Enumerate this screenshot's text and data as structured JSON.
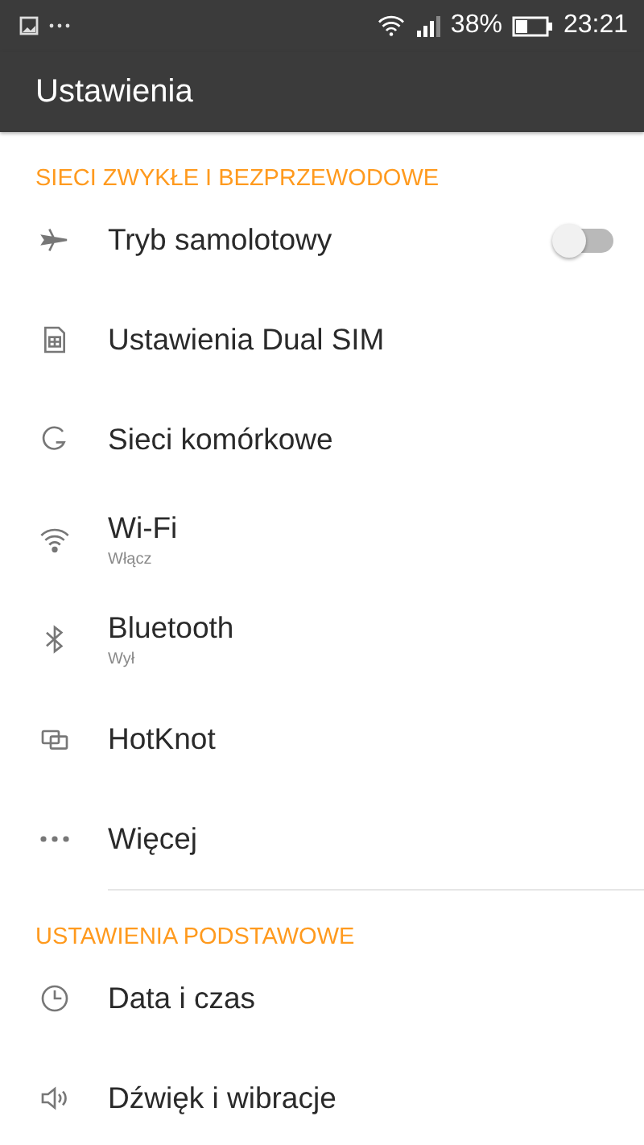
{
  "status_bar": {
    "battery_text": "38%",
    "time": "23:21"
  },
  "app_bar": {
    "title": "Ustawienia"
  },
  "sections": [
    {
      "title": "SIECI ZWYKŁE I BEZPRZEWODOWE",
      "items": [
        {
          "kind": "toggle",
          "label": "Tryb samolotowy",
          "on": false
        },
        {
          "kind": "plain",
          "label": "Ustawienia Dual SIM"
        },
        {
          "kind": "plain",
          "label": "Sieci komórkowe"
        },
        {
          "kind": "plain",
          "label": "Wi-Fi",
          "summary": "Włącz"
        },
        {
          "kind": "plain",
          "label": "Bluetooth",
          "summary": "Wył"
        },
        {
          "kind": "plain",
          "label": "HotKnot"
        },
        {
          "kind": "plain",
          "label": "Więcej"
        }
      ]
    },
    {
      "title": "USTAWIENIA PODSTAWOWE",
      "items": [
        {
          "kind": "plain",
          "label": "Data i czas"
        },
        {
          "kind": "plain",
          "label": "Dźwięk i wibracje"
        }
      ]
    }
  ]
}
